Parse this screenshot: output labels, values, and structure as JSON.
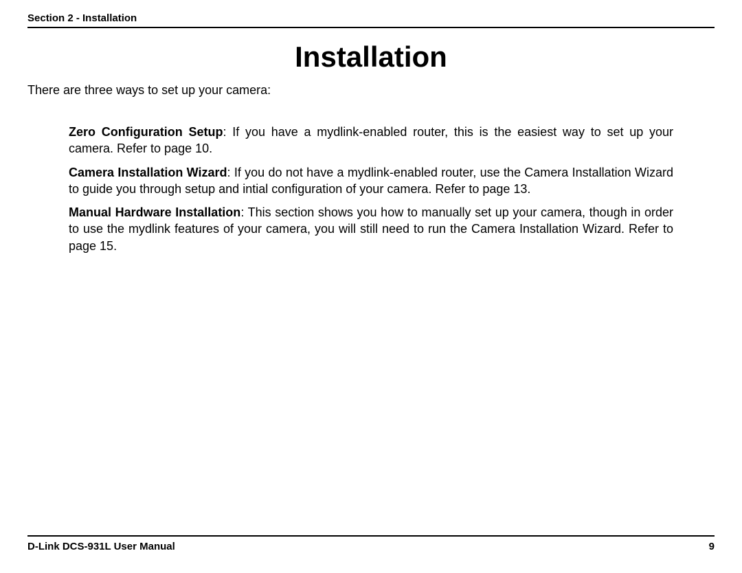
{
  "header": {
    "section_label": "Section 2 - Installation"
  },
  "title": "Installation",
  "intro": "There are three ways to set up your camera:",
  "methods": [
    {
      "lead": "Zero Configuration Setup",
      "text": ": If you have a mydlink-enabled router, this is the easiest way to set up your camera. Refer to page 10."
    },
    {
      "lead": "Camera Installation Wizard",
      "text": ": If you do not have a mydlink-enabled router, use the Camera Installation Wizard to guide you through setup and intial configuration of your camera. Refer to page 13."
    },
    {
      "lead": "Manual Hardware Installation",
      "text": ": This section shows you how to manually set up your camera, though in order to use the mydlink features of your camera, you will still need to run the Camera Installation Wizard. Refer to page 15."
    }
  ],
  "footer": {
    "manual_label": "D-Link DCS-931L User Manual",
    "page_number": "9"
  }
}
